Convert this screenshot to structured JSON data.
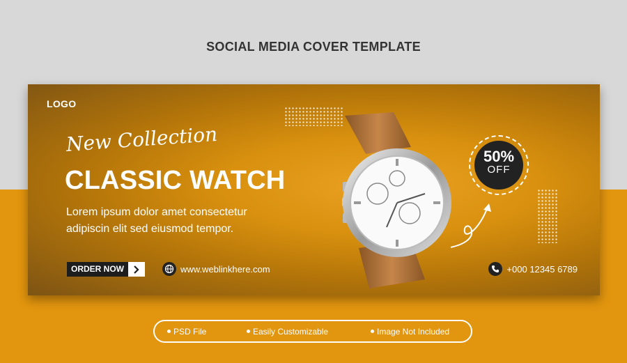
{
  "page": {
    "title": "SOCIAL MEDIA COVER TEMPLATE"
  },
  "cover": {
    "logo": "LOGO",
    "script_text": "New Collection",
    "headline": "CLASSIC WATCH",
    "description": "Lorem ipsum dolor amet consectetur adipiscin elit sed eiusmod tempor.",
    "order_button": "ORDER NOW",
    "website": "www.weblinkhere.com",
    "phone": "+000 12345 6789",
    "discount": {
      "percent": "50%",
      "label": "OFF"
    }
  },
  "features": [
    "PSD File",
    "Easily Customizable",
    "Image Not Included"
  ],
  "colors": {
    "accent": "#e2950e",
    "dark": "#1d1d1d",
    "light_bg": "#d8d8d8"
  },
  "icons": [
    "chevron-right-icon",
    "globe-icon",
    "phone-icon",
    "curved-arrow-icon",
    "watch-image"
  ]
}
